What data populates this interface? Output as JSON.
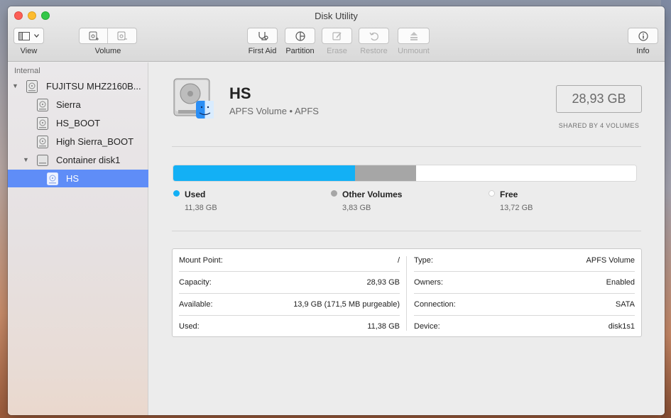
{
  "window": {
    "title": "Disk Utility"
  },
  "toolbar": {
    "view_label": "View",
    "volume_label": "Volume",
    "first_aid_label": "First Aid",
    "partition_label": "Partition",
    "erase_label": "Erase",
    "restore_label": "Restore",
    "unmount_label": "Unmount",
    "info_label": "Info"
  },
  "sidebar": {
    "header": "Internal",
    "items": [
      {
        "label": "FUJITSU MHZ2160B...",
        "level": 0,
        "icon": "hard-disk-icon"
      },
      {
        "label": "Sierra",
        "level": 1,
        "icon": "volume-icon"
      },
      {
        "label": "HS_BOOT",
        "level": 1,
        "icon": "volume-icon"
      },
      {
        "label": "High Sierra_BOOT",
        "level": 1,
        "icon": "volume-icon"
      },
      {
        "label": "Container disk1",
        "level": 1,
        "icon": "container-icon"
      },
      {
        "label": "HS",
        "level": 2,
        "icon": "volume-icon",
        "selected": true
      }
    ]
  },
  "volume": {
    "name": "HS",
    "subtitle": "APFS Volume • APFS",
    "size": "28,93 GB",
    "size_note": "SHARED BY 4 VOLUMES"
  },
  "usage": {
    "used": {
      "label": "Used",
      "value": "11,38 GB",
      "fraction": 0.393,
      "color": "#13b0f5"
    },
    "other": {
      "label": "Other Volumes",
      "value": "3,83 GB",
      "fraction": 0.132,
      "color": "#a6a6a6"
    },
    "free": {
      "label": "Free",
      "value": "13,72 GB",
      "fraction": 0.475,
      "color": "#ffffff"
    }
  },
  "details": {
    "left": [
      {
        "key": "Mount Point:",
        "value": "/"
      },
      {
        "key": "Capacity:",
        "value": "28,93 GB"
      },
      {
        "key": "Available:",
        "value": "13,9 GB (171,5 MB purgeable)"
      },
      {
        "key": "Used:",
        "value": "11,38 GB"
      }
    ],
    "right": [
      {
        "key": "Type:",
        "value": "APFS Volume"
      },
      {
        "key": "Owners:",
        "value": "Enabled"
      },
      {
        "key": "Connection:",
        "value": "SATA"
      },
      {
        "key": "Device:",
        "value": "disk1s1"
      }
    ]
  }
}
